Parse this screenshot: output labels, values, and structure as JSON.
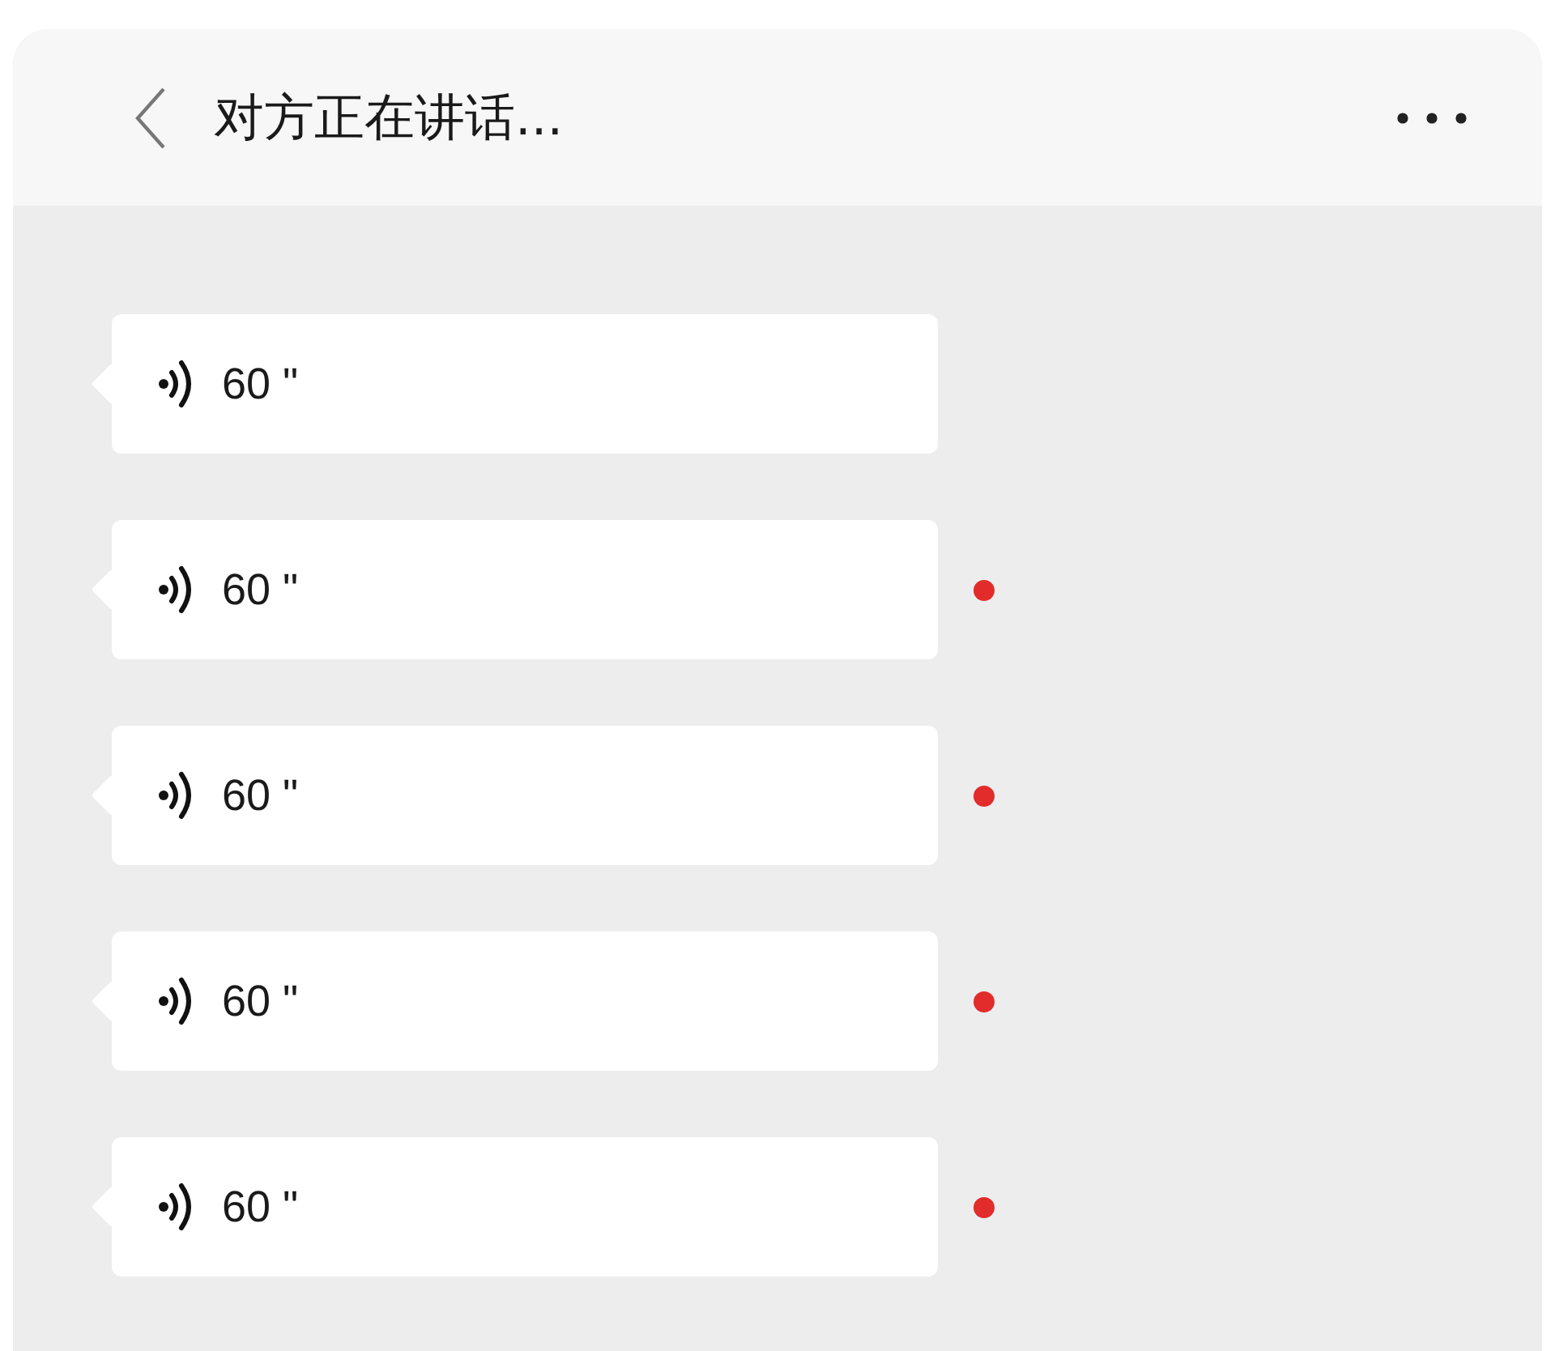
{
  "header": {
    "title": "对方正在讲话..."
  },
  "messages": [
    {
      "duration": "60 \"",
      "unread": false
    },
    {
      "duration": "60 \"",
      "unread": true
    },
    {
      "duration": "60 \"",
      "unread": true
    },
    {
      "duration": "60 \"",
      "unread": true
    },
    {
      "duration": "60 \"",
      "unread": true
    }
  ]
}
